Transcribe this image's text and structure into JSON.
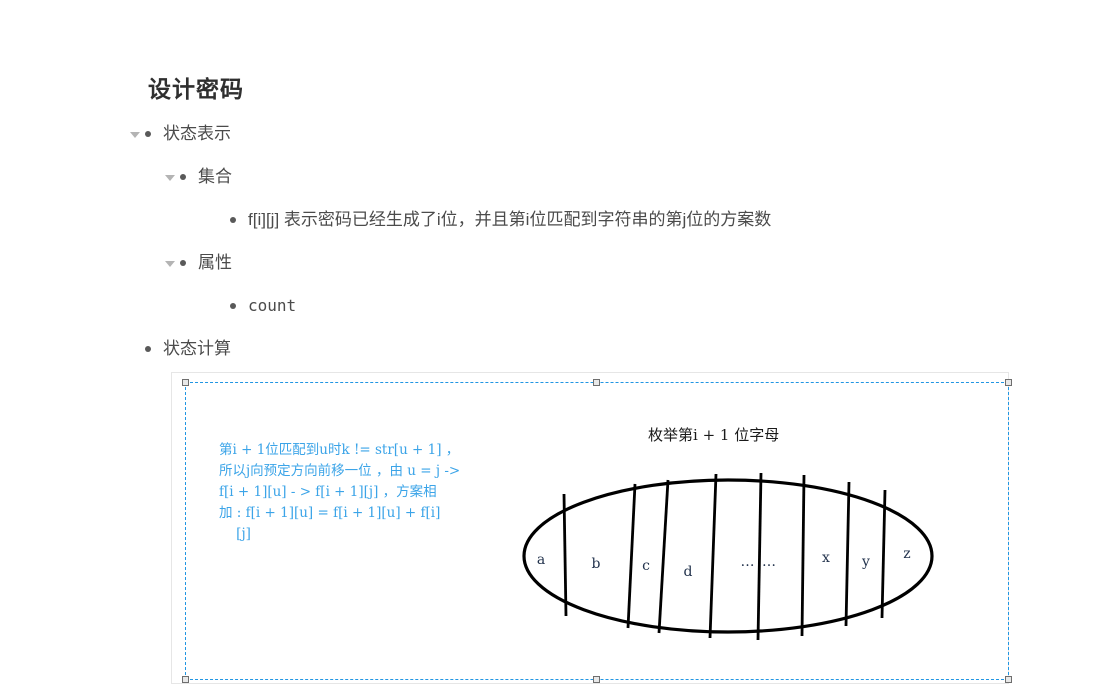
{
  "document": {
    "title": "设计密码"
  },
  "outline": [
    {
      "level": 1,
      "label": "状态表示",
      "has_toggle": true,
      "mono": false
    },
    {
      "level": 2,
      "label": "集合",
      "has_toggle": true,
      "mono": false
    },
    {
      "level": 3,
      "label": "f[i][j] 表示密码已经生成了i位，并且第i位匹配到字符串的第j位的方案数",
      "has_toggle": false,
      "mono": false
    },
    {
      "level": 2,
      "label": "属性",
      "has_toggle": true,
      "mono": false
    },
    {
      "level": 3,
      "label": "count",
      "has_toggle": false,
      "mono": true
    },
    {
      "level": 1,
      "label": "状态计算",
      "has_toggle": false,
      "mono": false
    }
  ],
  "image_block": {
    "selected": true,
    "annotation": "第i + 1位匹配到u时k != str[u + 1] ，\n所以j向预定方向前移一位 ，由 u = j ->\nf[i + 1][u] - > f[i + 1][j] ，方案相\n加 : f[i + 1][u] = f[i + 1][u] + f[i]\n    [j]",
    "annotation_color": "#3ba4e8",
    "diagram": {
      "caption": "枚举第i + 1 位字母",
      "cells": [
        "a",
        "b",
        "c",
        "d",
        "… …",
        "x",
        "y",
        "z"
      ],
      "shape": "ellipse"
    },
    "handles": [
      "top-left",
      "top-center",
      "top-right",
      "bottom-left",
      "bottom-center",
      "bottom-right"
    ]
  },
  "theme": {
    "accent": "#2196e3",
    "text": "#4b4b4b",
    "title": "#2f2f2f",
    "bullet": "#595959",
    "toggle": "#b4b4b4",
    "card_border": "#e6e6e6"
  }
}
